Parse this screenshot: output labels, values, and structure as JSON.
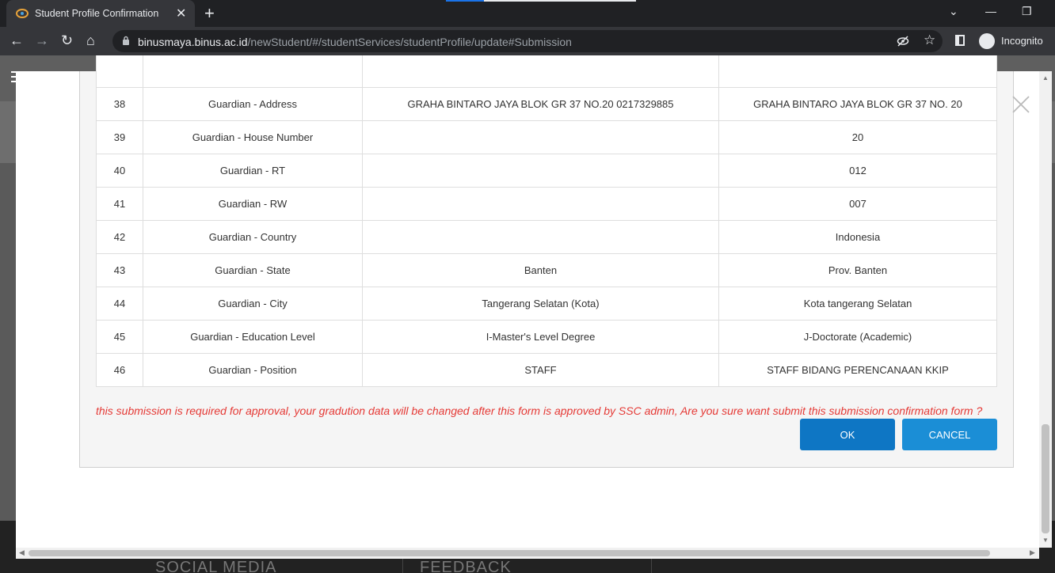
{
  "browser": {
    "tab_title": "Student Profile Confirmation",
    "url_host": "binusmaya.binus.ac.id",
    "url_path": "/newStudent/#/studentServices/studentProfile/update#Submission",
    "incognito_label": "Incognito"
  },
  "rows": [
    {
      "no": "38",
      "field": "Guardian - Address",
      "old": "GRAHA BINTARO JAYA BLOK GR 37 NO.20 0217329885",
      "new": "GRAHA BINTARO JAYA BLOK GR 37 NO. 20"
    },
    {
      "no": "39",
      "field": "Guardian - House Number",
      "old": "",
      "new": "20"
    },
    {
      "no": "40",
      "field": "Guardian - RT",
      "old": "",
      "new": "012"
    },
    {
      "no": "41",
      "field": "Guardian - RW",
      "old": "",
      "new": "007"
    },
    {
      "no": "42",
      "field": "Guardian - Country",
      "old": "",
      "new": "Indonesia"
    },
    {
      "no": "43",
      "field": "Guardian - State",
      "old": "Banten",
      "new": "Prov. Banten"
    },
    {
      "no": "44",
      "field": "Guardian - City",
      "old": "Tangerang Selatan (Kota)",
      "new": "Kota tangerang Selatan"
    },
    {
      "no": "45",
      "field": "Guardian - Education Level",
      "old": "I-Master's Level Degree",
      "new": "J-Doctorate (Academic)"
    },
    {
      "no": "46",
      "field": "Guardian - Position",
      "old": "STAFF",
      "new": "STAFF BIDANG PERENCANAAN KKIP"
    }
  ],
  "confirm_message": "this submission is required for approval, your gradution data will be changed after this form is approved by SSC admin, Are you sure want submit this submission confirmation form ?",
  "buttons": {
    "ok": "OK",
    "cancel": "CANCEL"
  },
  "footer": {
    "social": "SOCIAL MEDIA",
    "feedback": "FEEDBACK"
  },
  "colors": {
    "message": "#e53935",
    "ok": "#0e76c4",
    "cancel": "#1b8ed6"
  }
}
